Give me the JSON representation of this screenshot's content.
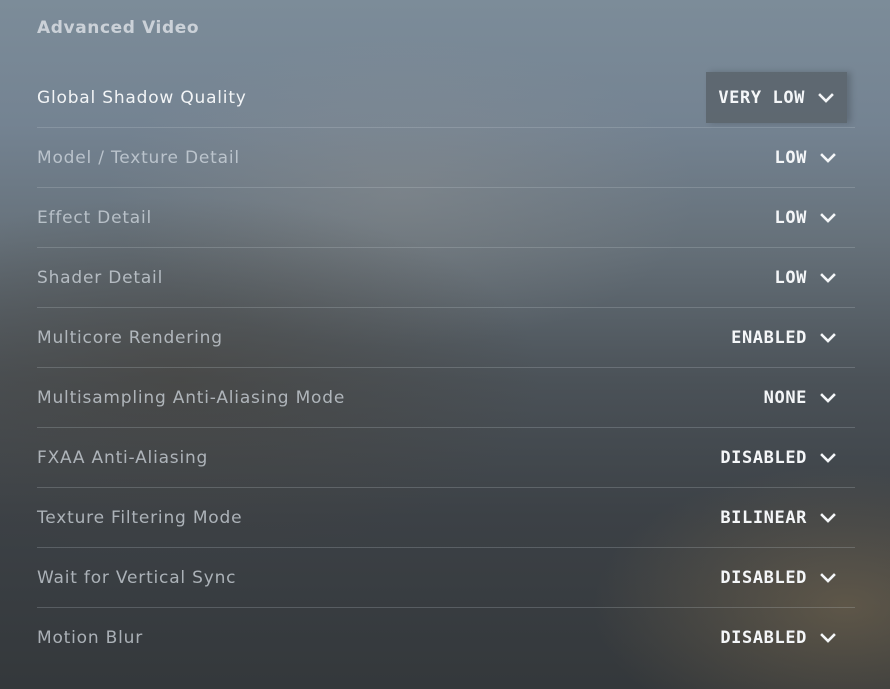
{
  "section": {
    "title": "Advanced Video"
  },
  "settings": [
    {
      "label": "Global Shadow Quality",
      "value": "VERY LOW",
      "selected": true
    },
    {
      "label": "Model / Texture Detail",
      "value": "LOW"
    },
    {
      "label": "Effect Detail",
      "value": "LOW"
    },
    {
      "label": "Shader Detail",
      "value": "LOW"
    },
    {
      "label": "Multicore Rendering",
      "value": "ENABLED"
    },
    {
      "label": "Multisampling Anti-Aliasing Mode",
      "value": "NONE"
    },
    {
      "label": "FXAA Anti-Aliasing",
      "value": "DISABLED"
    },
    {
      "label": "Texture Filtering Mode",
      "value": "BILINEAR"
    },
    {
      "label": "Wait for Vertical Sync",
      "value": "DISABLED"
    },
    {
      "label": "Motion Blur",
      "value": "DISABLED"
    }
  ],
  "icons": {
    "dropdown": "chevron-down-icon"
  }
}
